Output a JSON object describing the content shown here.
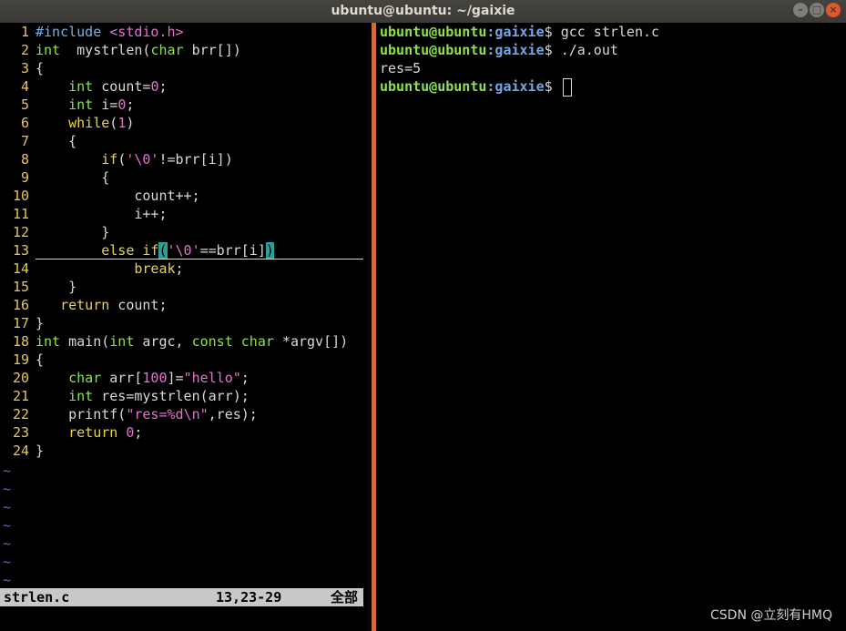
{
  "window": {
    "title": "ubuntu@ubuntu: ~/gaixie"
  },
  "vim": {
    "lines": [
      {
        "n": "1",
        "segs": [
          [
            "pp",
            "#include "
          ],
          [
            "str",
            "<stdio.h>"
          ]
        ]
      },
      {
        "n": "2",
        "segs": [
          [
            "ty",
            "int"
          ],
          [
            "",
            "  mystrlen("
          ],
          [
            "ty",
            "char"
          ],
          [
            "",
            " brr[])"
          ]
        ]
      },
      {
        "n": "3",
        "segs": [
          [
            "",
            "{"
          ]
        ]
      },
      {
        "n": "4",
        "segs": [
          [
            "",
            "    "
          ],
          [
            "ty",
            "int"
          ],
          [
            "",
            " count="
          ],
          [
            "num",
            "0"
          ],
          [
            "",
            ";"
          ]
        ]
      },
      {
        "n": "5",
        "segs": [
          [
            "",
            "    "
          ],
          [
            "ty",
            "int"
          ],
          [
            "",
            " i="
          ],
          [
            "num",
            "0"
          ],
          [
            "",
            ";"
          ]
        ]
      },
      {
        "n": "6",
        "segs": [
          [
            "",
            "    "
          ],
          [
            "kw",
            "while"
          ],
          [
            "",
            "("
          ],
          [
            "num",
            "1"
          ],
          [
            "",
            ")"
          ]
        ]
      },
      {
        "n": "7",
        "segs": [
          [
            "",
            "    {"
          ]
        ]
      },
      {
        "n": "8",
        "segs": [
          [
            "",
            "        "
          ],
          [
            "kw",
            "if"
          ],
          [
            "",
            "("
          ],
          [
            "str",
            "'\\0'"
          ],
          [
            "",
            "!=brr[i])"
          ]
        ]
      },
      {
        "n": "9",
        "segs": [
          [
            "",
            "        {"
          ]
        ]
      },
      {
        "n": "10",
        "segs": [
          [
            "",
            "            count++;"
          ]
        ]
      },
      {
        "n": "11",
        "segs": [
          [
            "",
            "            i++;"
          ]
        ]
      },
      {
        "n": "12",
        "segs": [
          [
            "",
            "        }"
          ]
        ]
      },
      {
        "n": "13",
        "segs": [
          [
            "",
            "        "
          ],
          [
            "kw",
            "else"
          ],
          [
            "",
            " "
          ],
          [
            "kw",
            "if"
          ],
          [
            "paren-hl",
            "("
          ],
          [
            "str",
            "'\\0'"
          ],
          [
            "",
            "==brr[i]"
          ],
          [
            "paren-hl",
            ")"
          ]
        ],
        "cursor": true
      },
      {
        "n": "14",
        "segs": [
          [
            "",
            "            "
          ],
          [
            "kw",
            "break"
          ],
          [
            "",
            ";"
          ]
        ]
      },
      {
        "n": "15",
        "segs": [
          [
            "",
            "    }"
          ]
        ]
      },
      {
        "n": "16",
        "segs": [
          [
            "",
            "   "
          ],
          [
            "kw",
            "return"
          ],
          [
            "",
            " count;"
          ]
        ]
      },
      {
        "n": "17",
        "segs": [
          [
            "",
            "}"
          ]
        ]
      },
      {
        "n": "18",
        "segs": [
          [
            "ty",
            "int"
          ],
          [
            "",
            " main("
          ],
          [
            "ty",
            "int"
          ],
          [
            "",
            " argc, "
          ],
          [
            "ty",
            "const"
          ],
          [
            "",
            " "
          ],
          [
            "ty",
            "char"
          ],
          [
            "",
            " *argv[])"
          ]
        ]
      },
      {
        "n": "19",
        "segs": [
          [
            "",
            "{"
          ]
        ]
      },
      {
        "n": "20",
        "segs": [
          [
            "",
            "    "
          ],
          [
            "ty",
            "char"
          ],
          [
            "",
            " arr["
          ],
          [
            "num",
            "100"
          ],
          [
            "",
            "]="
          ],
          [
            "str",
            "\"hello\""
          ],
          [
            "",
            ";"
          ]
        ]
      },
      {
        "n": "21",
        "segs": [
          [
            "",
            "    "
          ],
          [
            "ty",
            "int"
          ],
          [
            "",
            " res=mystrlen(arr);"
          ]
        ]
      },
      {
        "n": "22",
        "segs": [
          [
            "",
            "    printf("
          ],
          [
            "str",
            "\"res=%d\\n\""
          ],
          [
            "",
            ",res);"
          ]
        ]
      },
      {
        "n": "23",
        "segs": [
          [
            "",
            "    "
          ],
          [
            "kw",
            "return"
          ],
          [
            "",
            " "
          ],
          [
            "num",
            "0"
          ],
          [
            "",
            ";"
          ]
        ]
      },
      {
        "n": "24",
        "segs": [
          [
            "",
            "}"
          ]
        ]
      }
    ],
    "tilde": "~",
    "status": {
      "filename": "strlen.c",
      "position": "13,23-29",
      "scroll": "全部"
    }
  },
  "terminal": {
    "user_host": "ubuntu@ubuntu",
    "path": ":gaixie",
    "prompt_suffix": "$ ",
    "lines": [
      {
        "type": "prompt",
        "cmd": "gcc strlen.c"
      },
      {
        "type": "prompt",
        "cmd": "./a.out"
      },
      {
        "type": "output",
        "text": "res=5"
      },
      {
        "type": "prompt",
        "cmd": "",
        "cursor": true
      }
    ]
  },
  "watermark": "CSDN @立刻有HMQ",
  "colors": {
    "divider": "#d16b45",
    "prompt_user": "#8be24c",
    "prompt_path": "#6fa7e8"
  }
}
